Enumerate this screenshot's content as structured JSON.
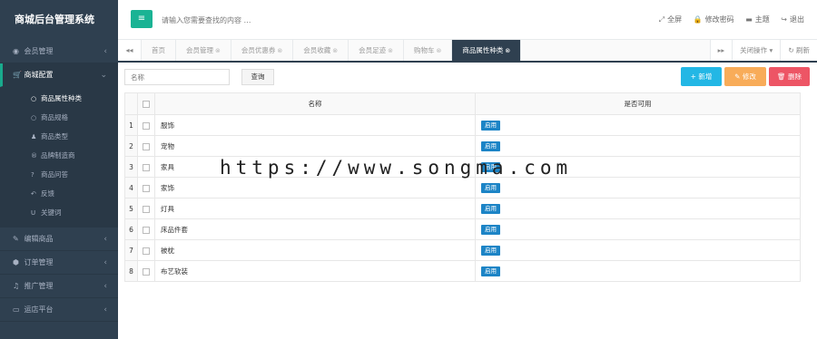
{
  "app": {
    "title": "商城后台管理系统"
  },
  "sidebar": {
    "groups": [
      {
        "icon": "user-circle-icon",
        "label": "会员管理",
        "glyph": "◉",
        "arrow": "‹"
      },
      {
        "icon": "cart-icon",
        "label": "商城配置",
        "glyph": "▾",
        "arrow": "⌄"
      },
      {
        "icon": "edit-icon",
        "label": "编辑商品",
        "glyph": "✎",
        "arrow": "‹"
      },
      {
        "icon": "cube-icon",
        "label": "订单管理",
        "glyph": "⬢",
        "arrow": "‹"
      },
      {
        "icon": "bell-icon",
        "label": "推广管理",
        "glyph": "♫",
        "arrow": "‹"
      },
      {
        "icon": "monitor-icon",
        "label": "运店平台",
        "glyph": "▭",
        "arrow": "‹"
      }
    ],
    "subitems": [
      {
        "icon": "circle-icon",
        "glyph": "○",
        "label": "商品属性种类"
      },
      {
        "icon": "circle-icon",
        "glyph": "○",
        "label": "商品规格"
      },
      {
        "icon": "user-icon",
        "glyph": "♟",
        "label": "商品类型"
      },
      {
        "icon": "registered-icon",
        "glyph": "®",
        "label": "品牌制造商"
      },
      {
        "icon": "question-circle-icon",
        "glyph": "?",
        "label": "商品问答"
      },
      {
        "icon": "reply-icon",
        "glyph": "↶",
        "label": "反馈"
      },
      {
        "icon": "underline-icon",
        "glyph": "U",
        "label": "关键词"
      }
    ]
  },
  "header": {
    "menu_toggle_glyph": "≡",
    "search_placeholder": "请输入您需要查找的内容 …",
    "actions": [
      {
        "icon": "expand-icon",
        "glyph": "⤢",
        "label": "全屏"
      },
      {
        "icon": "lock-icon",
        "glyph": "🔒",
        "label": "修改密码"
      },
      {
        "icon": "theme-icon",
        "glyph": "▬",
        "label": "主题"
      },
      {
        "icon": "logout-icon",
        "glyph": "↪",
        "label": "退出"
      }
    ]
  },
  "tabs": {
    "scroll_left": "◂◂",
    "scroll_right": "▸▸",
    "close_glyph": "⊗",
    "items": [
      {
        "label": "首页",
        "closable": false,
        "active": false
      },
      {
        "label": "会员管理",
        "closable": true,
        "active": false
      },
      {
        "label": "会员优惠券",
        "closable": true,
        "active": false
      },
      {
        "label": "会员收藏",
        "closable": true,
        "active": false
      },
      {
        "label": "会员足迹",
        "closable": true,
        "active": false
      },
      {
        "label": "购物车",
        "closable": true,
        "active": false
      },
      {
        "label": "商品属性种类",
        "closable": true,
        "active": true
      }
    ],
    "close_ops": "关闭操作 ▾",
    "refresh_glyph": "↻",
    "refresh": "刷新"
  },
  "toolbar": {
    "filter_placeholder": "名称",
    "query": "查询",
    "add": "+ 新增",
    "edit": "✎ 修改",
    "delete": "🗑 删除"
  },
  "table": {
    "columns": {
      "name": "名称",
      "available": "是否可用"
    },
    "rows": [
      {
        "num": "1",
        "name": "服饰",
        "available": "启用"
      },
      {
        "num": "2",
        "name": "宠物",
        "available": "启用"
      },
      {
        "num": "3",
        "name": "家具",
        "available": "启用"
      },
      {
        "num": "4",
        "name": "家饰",
        "available": "启用"
      },
      {
        "num": "5",
        "name": "灯具",
        "available": "启用"
      },
      {
        "num": "6",
        "name": "床品件套",
        "available": "启用"
      },
      {
        "num": "7",
        "name": "被枕",
        "available": "启用"
      },
      {
        "num": "8",
        "name": "布艺软装",
        "available": "启用"
      }
    ]
  },
  "watermark": "https://www.songma.com",
  "colors": {
    "sidebar": "#2f4050",
    "accent": "#1ab394",
    "add": "#23b7e5",
    "edit": "#f8ac59",
    "delete": "#ed5565",
    "badge": "#1c84c6"
  }
}
